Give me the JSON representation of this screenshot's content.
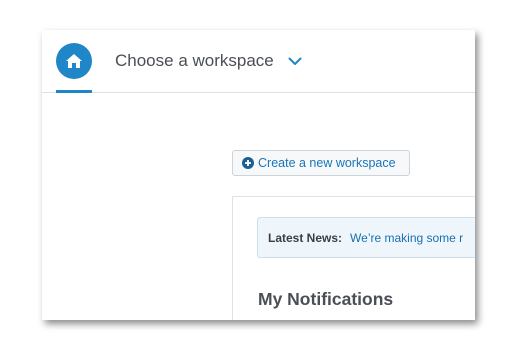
{
  "header": {
    "workspace_label": "Choose a workspace",
    "home_icon": "home-icon",
    "chevron_icon": "chevron-down-icon"
  },
  "actions": {
    "create_workspace_label": "Create a new workspace",
    "create_icon": "plus-circle-icon"
  },
  "news": {
    "label": "Latest News:",
    "text": "We’re making some r"
  },
  "notifications": {
    "title": "My Notifications"
  },
  "colors": {
    "accent": "#1f87c7",
    "link": "#1976b8",
    "news_bg": "#eef6fb"
  }
}
